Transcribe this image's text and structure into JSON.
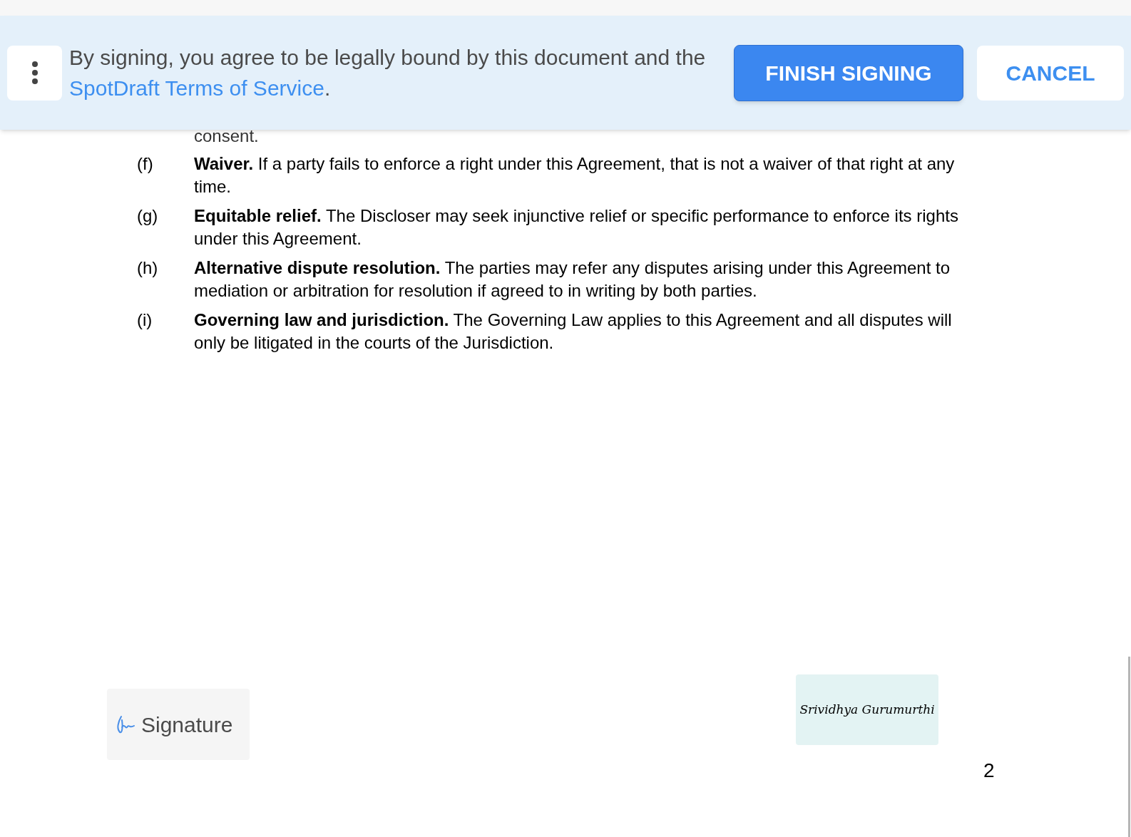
{
  "banner": {
    "notice": "By signing, you agree to be legally bound by this document and the",
    "link": "SpotDraft Terms of Service",
    "after_link": ".",
    "buttons": [
      {
        "label": "FINISH SIGNING",
        "kind": "primary"
      },
      {
        "label": "CANCEL",
        "kind": "secondary"
      }
    ]
  },
  "document": {
    "leading_text": "consent.",
    "clauses": [
      {
        "label": "(f)",
        "text": "**Waiver.** If a party fails to enforce a right under this Agreement, that is not a waiver of that right at any time."
      },
      {
        "label": "(g)",
        "text": "**Equitable relief.** The Discloser may seek injunctive relief or specific performance to enforce its rights under this Agreement."
      },
      {
        "label": "(h)",
        "text": "**Alternative dispute resolution.** The parties may refer any disputes arising under this Agreement to mediation or arbitration for resolution if agreed to in writing by both parties."
      },
      {
        "label": "(i)",
        "text": "**Governing law and jurisdiction.** The Governing Law applies to this Agreement and all disputes will only be litigated in the courts of the Jurisdiction."
      }
    ],
    "signature_field": {
      "label": "Signature"
    },
    "signed_signature": "Srividhya Gurumurthi",
    "page_number": "2"
  }
}
